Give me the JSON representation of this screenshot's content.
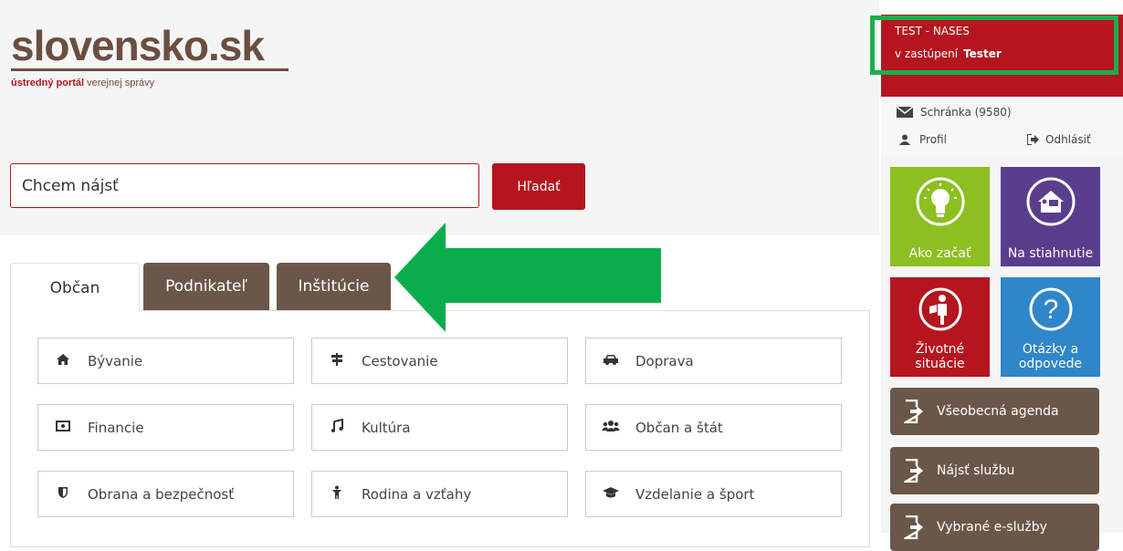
{
  "logo": {
    "word": "slovensko.sk",
    "sub_red": "ústredný portál",
    "sub_rest": "verejnej správy"
  },
  "search": {
    "placeholder": "Chcem nájsť",
    "button": "Hľadať"
  },
  "tabs": [
    {
      "label": "Občan",
      "active": true
    },
    {
      "label": "Podnikateľ",
      "active": false
    },
    {
      "label": "Inštitúcie",
      "active": false
    }
  ],
  "categories": [
    {
      "label": "Bývanie",
      "icon": "home-icon",
      "glyph": "⌂"
    },
    {
      "label": "Cestovanie",
      "icon": "signpost-icon",
      "glyph": "⥯"
    },
    {
      "label": "Doprava",
      "icon": "car-icon",
      "glyph": "⛟"
    },
    {
      "label": "Financie",
      "icon": "money-icon",
      "glyph": "▣"
    },
    {
      "label": "Kultúra",
      "icon": "music-icon",
      "glyph": "♫"
    },
    {
      "label": "Občan a štát",
      "icon": "group-icon",
      "glyph": "⚇"
    },
    {
      "label": "Obrana a bezpečnosť",
      "icon": "shield-icon",
      "glyph": "⛉"
    },
    {
      "label": "Rodina a vzťahy",
      "icon": "child-icon",
      "glyph": "♙"
    },
    {
      "label": "Vzdelanie a šport",
      "icon": "graduation-cap-icon",
      "glyph": "⛭"
    }
  ],
  "user": {
    "name": "TEST - NASES",
    "on_behalf_label": "v zastúpení",
    "on_behalf_name": "Tester",
    "mailbox": "Schránka (9580)",
    "profile": "Profil",
    "logout": "Odhlásiť"
  },
  "tiles": [
    {
      "label": "Ako začať",
      "color": "#8cbf1f",
      "icon": "lightbulb-icon"
    },
    {
      "label": "Na stiahnutie",
      "color": "#5a3e8e",
      "icon": "download-house-icon"
    },
    {
      "label": "Životné situácie",
      "color": "#b5151e",
      "icon": "life-situations-icon"
    },
    {
      "label": "Otázky a odpovede",
      "color": "#2f86c9",
      "icon": "question-icon"
    }
  ],
  "side_buttons": [
    {
      "label": "Všeobecná agenda"
    },
    {
      "label": "Nájsť službu"
    },
    {
      "label": "Vybrané e-služby"
    }
  ],
  "colors": {
    "brand_red": "#b5151e",
    "brown": "#6b5749",
    "highlight_green": "#17b04a"
  }
}
